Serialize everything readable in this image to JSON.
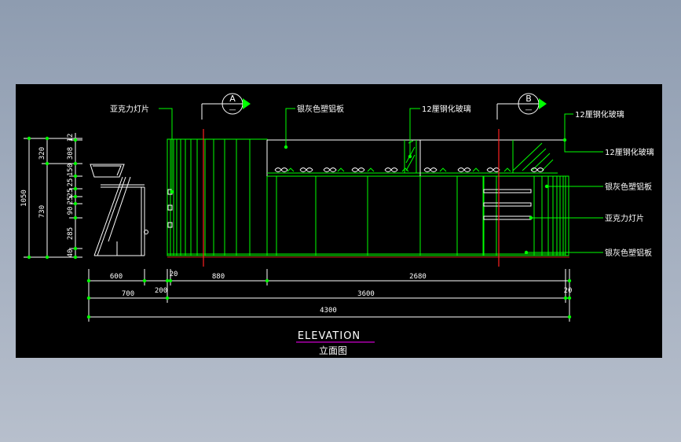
{
  "title": "ELEVATION",
  "subtitle": "立面图",
  "section_markers": [
    {
      "letter": "A",
      "sub": "—"
    },
    {
      "letter": "B",
      "sub": "—"
    }
  ],
  "callouts": {
    "acrylic_light_left": "亚克力灯片",
    "silver_gray_aluminum_top": "银灰色塑铝板",
    "tempered_glass_top": "12厘钢化玻璃",
    "tempered_glass_right_upper": "12厘钢化玻璃",
    "tempered_glass_right_lower": "12厘钢化玻璃",
    "silver_gray_aluminum_right": "银灰色塑铝板",
    "acrylic_light_right": "亚克力灯片",
    "silver_gray_aluminum_bottom": "银灰色塑铝板"
  },
  "left_dims": {
    "total": "1050",
    "upper": "320",
    "lower": "730",
    "segments": [
      "12",
      "308",
      "150",
      "25",
      "25",
      "25",
      "90",
      "285",
      "40"
    ]
  },
  "bottom_dims": {
    "row1": [
      "600",
      "20",
      "880",
      "2680"
    ],
    "row2": [
      "700",
      "200",
      "3600",
      "20"
    ],
    "row3": [
      "4300"
    ]
  },
  "colors": {
    "line": "#ffffff",
    "green": "#00ff00",
    "red": "#ff2020",
    "magenta": "#ff00ff",
    "background": "#000000"
  }
}
